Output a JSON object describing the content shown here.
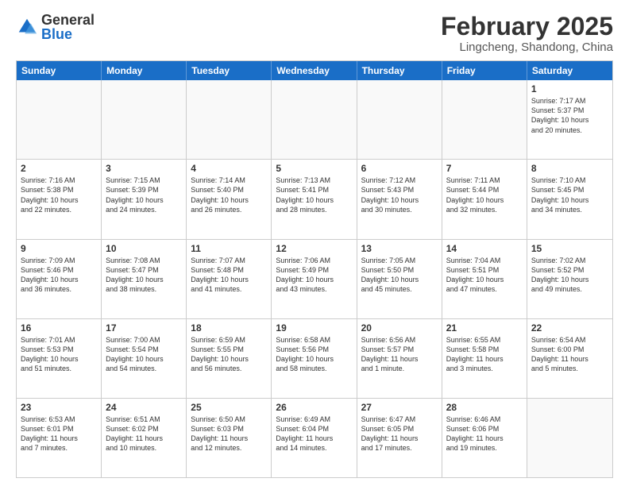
{
  "logo": {
    "general": "General",
    "blue": "Blue"
  },
  "title": "February 2025",
  "location": "Lingcheng, Shandong, China",
  "header_days": [
    "Sunday",
    "Monday",
    "Tuesday",
    "Wednesday",
    "Thursday",
    "Friday",
    "Saturday"
  ],
  "weeks": [
    [
      {
        "day": "",
        "info": ""
      },
      {
        "day": "",
        "info": ""
      },
      {
        "day": "",
        "info": ""
      },
      {
        "day": "",
        "info": ""
      },
      {
        "day": "",
        "info": ""
      },
      {
        "day": "",
        "info": ""
      },
      {
        "day": "1",
        "info": "Sunrise: 7:17 AM\nSunset: 5:37 PM\nDaylight: 10 hours\nand 20 minutes."
      }
    ],
    [
      {
        "day": "2",
        "info": "Sunrise: 7:16 AM\nSunset: 5:38 PM\nDaylight: 10 hours\nand 22 minutes."
      },
      {
        "day": "3",
        "info": "Sunrise: 7:15 AM\nSunset: 5:39 PM\nDaylight: 10 hours\nand 24 minutes."
      },
      {
        "day": "4",
        "info": "Sunrise: 7:14 AM\nSunset: 5:40 PM\nDaylight: 10 hours\nand 26 minutes."
      },
      {
        "day": "5",
        "info": "Sunrise: 7:13 AM\nSunset: 5:41 PM\nDaylight: 10 hours\nand 28 minutes."
      },
      {
        "day": "6",
        "info": "Sunrise: 7:12 AM\nSunset: 5:43 PM\nDaylight: 10 hours\nand 30 minutes."
      },
      {
        "day": "7",
        "info": "Sunrise: 7:11 AM\nSunset: 5:44 PM\nDaylight: 10 hours\nand 32 minutes."
      },
      {
        "day": "8",
        "info": "Sunrise: 7:10 AM\nSunset: 5:45 PM\nDaylight: 10 hours\nand 34 minutes."
      }
    ],
    [
      {
        "day": "9",
        "info": "Sunrise: 7:09 AM\nSunset: 5:46 PM\nDaylight: 10 hours\nand 36 minutes."
      },
      {
        "day": "10",
        "info": "Sunrise: 7:08 AM\nSunset: 5:47 PM\nDaylight: 10 hours\nand 38 minutes."
      },
      {
        "day": "11",
        "info": "Sunrise: 7:07 AM\nSunset: 5:48 PM\nDaylight: 10 hours\nand 41 minutes."
      },
      {
        "day": "12",
        "info": "Sunrise: 7:06 AM\nSunset: 5:49 PM\nDaylight: 10 hours\nand 43 minutes."
      },
      {
        "day": "13",
        "info": "Sunrise: 7:05 AM\nSunset: 5:50 PM\nDaylight: 10 hours\nand 45 minutes."
      },
      {
        "day": "14",
        "info": "Sunrise: 7:04 AM\nSunset: 5:51 PM\nDaylight: 10 hours\nand 47 minutes."
      },
      {
        "day": "15",
        "info": "Sunrise: 7:02 AM\nSunset: 5:52 PM\nDaylight: 10 hours\nand 49 minutes."
      }
    ],
    [
      {
        "day": "16",
        "info": "Sunrise: 7:01 AM\nSunset: 5:53 PM\nDaylight: 10 hours\nand 51 minutes."
      },
      {
        "day": "17",
        "info": "Sunrise: 7:00 AM\nSunset: 5:54 PM\nDaylight: 10 hours\nand 54 minutes."
      },
      {
        "day": "18",
        "info": "Sunrise: 6:59 AM\nSunset: 5:55 PM\nDaylight: 10 hours\nand 56 minutes."
      },
      {
        "day": "19",
        "info": "Sunrise: 6:58 AM\nSunset: 5:56 PM\nDaylight: 10 hours\nand 58 minutes."
      },
      {
        "day": "20",
        "info": "Sunrise: 6:56 AM\nSunset: 5:57 PM\nDaylight: 11 hours\nand 1 minute."
      },
      {
        "day": "21",
        "info": "Sunrise: 6:55 AM\nSunset: 5:58 PM\nDaylight: 11 hours\nand 3 minutes."
      },
      {
        "day": "22",
        "info": "Sunrise: 6:54 AM\nSunset: 6:00 PM\nDaylight: 11 hours\nand 5 minutes."
      }
    ],
    [
      {
        "day": "23",
        "info": "Sunrise: 6:53 AM\nSunset: 6:01 PM\nDaylight: 11 hours\nand 7 minutes."
      },
      {
        "day": "24",
        "info": "Sunrise: 6:51 AM\nSunset: 6:02 PM\nDaylight: 11 hours\nand 10 minutes."
      },
      {
        "day": "25",
        "info": "Sunrise: 6:50 AM\nSunset: 6:03 PM\nDaylight: 11 hours\nand 12 minutes."
      },
      {
        "day": "26",
        "info": "Sunrise: 6:49 AM\nSunset: 6:04 PM\nDaylight: 11 hours\nand 14 minutes."
      },
      {
        "day": "27",
        "info": "Sunrise: 6:47 AM\nSunset: 6:05 PM\nDaylight: 11 hours\nand 17 minutes."
      },
      {
        "day": "28",
        "info": "Sunrise: 6:46 AM\nSunset: 6:06 PM\nDaylight: 11 hours\nand 19 minutes."
      },
      {
        "day": "",
        "info": ""
      }
    ]
  ]
}
